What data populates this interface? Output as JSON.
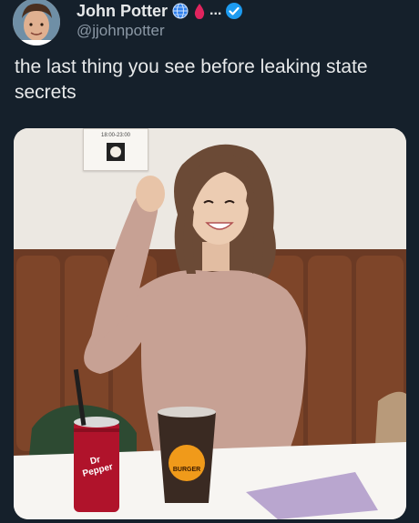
{
  "author": {
    "name": "John Potter",
    "handle": "@jjohnpotter",
    "badges": [
      "globe-icon",
      "blood-drop-icon",
      "more-dots-icon",
      "verified-badge-icon"
    ],
    "more": "...",
    "verified_color": "#1d9bf0"
  },
  "tweet": {
    "text": "the last thing you see before leaking state secrets"
  },
  "media": {
    "poster_text": "18:00-23:00",
    "can_brand": "Dr Pepper",
    "cup_brand": "BURGER"
  }
}
